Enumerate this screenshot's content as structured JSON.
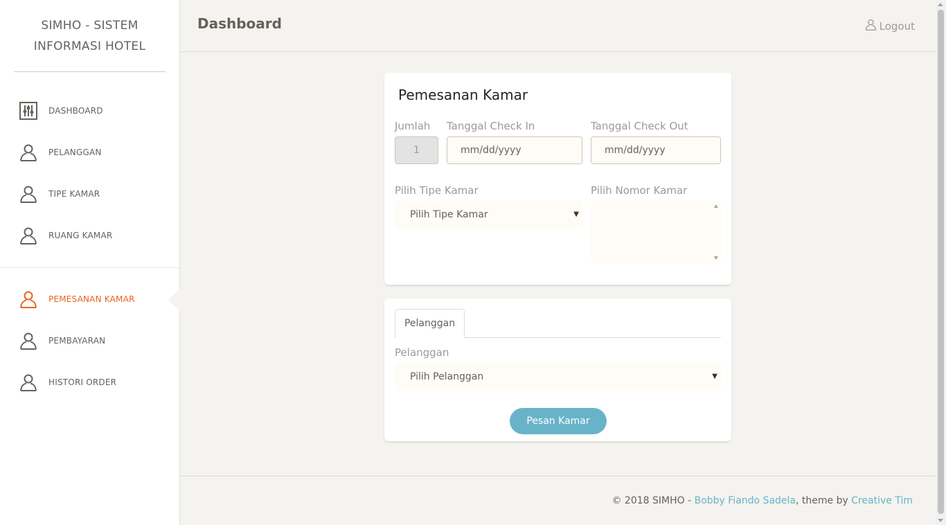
{
  "sidebar": {
    "logo_line1": "SIMHO - SISTEM",
    "logo_line2": "INFORMASI HOTEL",
    "items": [
      {
        "label": "DASHBOARD",
        "icon": "panel-settings-icon"
      },
      {
        "label": "PELANGGAN",
        "icon": "user-icon"
      },
      {
        "label": "TIPE KAMAR",
        "icon": "user-icon"
      },
      {
        "label": "RUANG KAMAR",
        "icon": "user-icon"
      },
      {
        "label": "PEMESANAN KAMAR",
        "icon": "user-icon",
        "active": true
      },
      {
        "label": "PEMBAYARAN",
        "icon": "user-icon"
      },
      {
        "label": "HISTORI ORDER",
        "icon": "user-icon"
      }
    ]
  },
  "header": {
    "title": "Dashboard",
    "logout_label": "Logout"
  },
  "booking": {
    "title": "Pemesanan Kamar",
    "jumlah_label": "Jumlah",
    "jumlah_value": "1",
    "checkin_label": "Tanggal Check In",
    "checkin_placeholder": "mm/dd/yyyy",
    "checkout_label": "Tanggal Check Out",
    "checkout_placeholder": "mm/dd/yyyy",
    "tipe_label": "Pilih Tipe Kamar",
    "tipe_selected": "Pilih Tipe Kamar",
    "nomor_label": "Pilih Nomor Kamar"
  },
  "customer": {
    "tab_label": "Pelanggan",
    "field_label": "Pelanggan",
    "selected": "Pilih Pelanggan",
    "submit_label": "Pesan Kamar"
  },
  "footer": {
    "prefix": "© 2018 SIMHO - ",
    "author": "Bobby Fiando Sadela",
    "middle": ", theme by ",
    "theme": "Creative Tim"
  },
  "colors": {
    "accent_active": "#e7651f",
    "button": "#68b3c8",
    "link": "#68b3c8",
    "background": "#f4f3ef"
  }
}
